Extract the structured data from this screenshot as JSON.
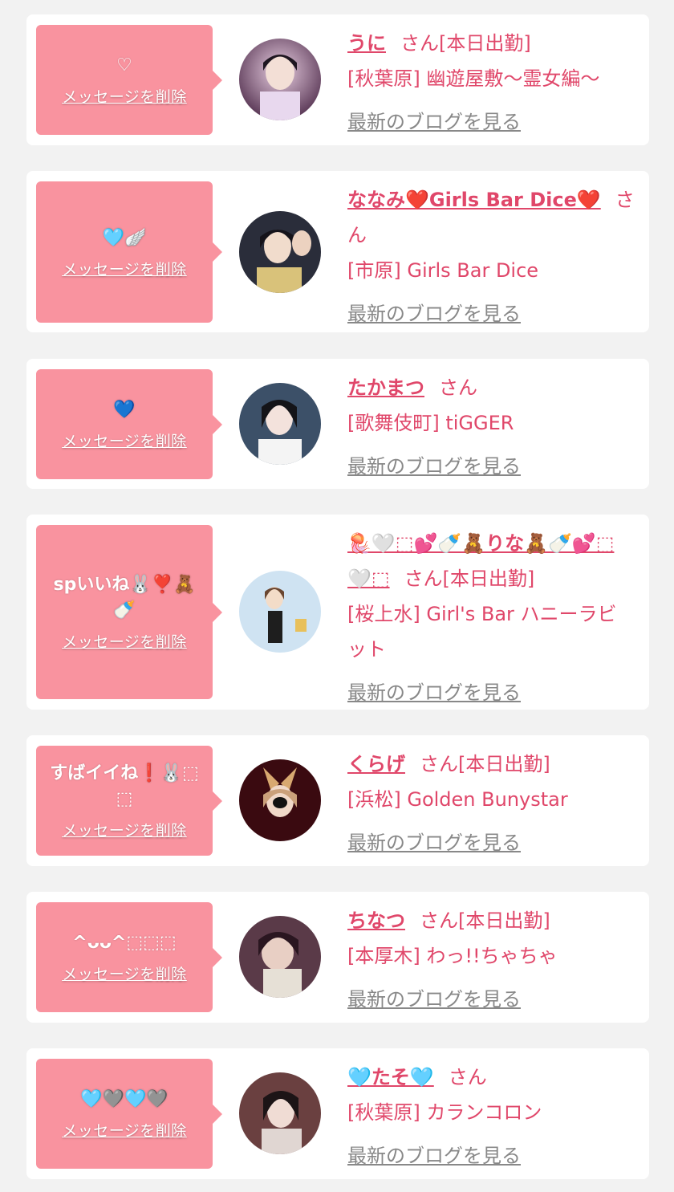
{
  "cards": [
    {
      "message": "♡",
      "delete_label": "メッセージを削除",
      "name": "うに",
      "suffix": "さん[本日出勤]",
      "shop": "[秋葉原] 幽遊屋敷〜霊女編〜",
      "blog": "最新のブログを見る",
      "avatar_colors": [
        "#3b2a3a",
        "#c9a6c6",
        "#6b4866"
      ]
    },
    {
      "message": "🩵🪽",
      "delete_label": "メッセージを削除",
      "name": "ななみ❤️Girls Bar Dice❤️",
      "suffix": "さん",
      "shop": "[市原] Girls Bar Dice",
      "blog": "最新のブログを見る",
      "avatar_colors": [
        "#2a2d3a",
        "#d9c7a0",
        "#4a5a7a"
      ]
    },
    {
      "message": "💙",
      "delete_label": "メッセージを削除",
      "name": "たかまつ",
      "suffix": "さん",
      "shop": "[歌舞伎町] tiGGER",
      "blog": "最新のブログを見る",
      "avatar_colors": [
        "#2e3a48",
        "#e8e0e0",
        "#4e6a86"
      ]
    },
    {
      "message": "spいいね🐰❣️🧸🍼",
      "delete_label": "メッセージを削除",
      "name": "🪼🤍⬚💕🍼🧸りな🧸🍼💕⬚🤍⬚",
      "suffix": "さん[本日出勤]",
      "shop": "[桜上水] Girl's Bar ハニーラビット",
      "blog": "最新のブログを見る",
      "avatar_colors": [
        "#cfe3f2",
        "#2b2b2b",
        "#f0c8a8"
      ]
    },
    {
      "message": "すばイイね❗️🐰⬚⬚",
      "delete_label": "メッセージを削除",
      "name": "くらげ",
      "suffix": "さん[本日出勤]",
      "shop": "[浜松] Golden Bunystar",
      "blog": "最新のブログを見る",
      "avatar_colors": [
        "#3a0a10",
        "#d8a870",
        "#7a2030"
      ]
    },
    {
      "message": "^ᴗᴗ^⬚⬚⬚",
      "delete_label": "メッセージを削除",
      "name": "ちなつ",
      "suffix": "さん[本日出勤]",
      "shop": "[本厚木] わっ!!ちゃちゃ",
      "blog": "最新のブログを見る",
      "avatar_colors": [
        "#5a3a48",
        "#e6d8d0",
        "#8a6070"
      ]
    },
    {
      "message": "🩵🩶🩵🩶",
      "delete_label": "メッセージを削除",
      "name": "🩵たそ🩵",
      "suffix": "さん",
      "shop": "[秋葉原] カランコロン",
      "blog": "最新のブログを見る",
      "avatar_colors": [
        "#4a2a2a",
        "#e8d0c8",
        "#7a4a40"
      ]
    }
  ]
}
